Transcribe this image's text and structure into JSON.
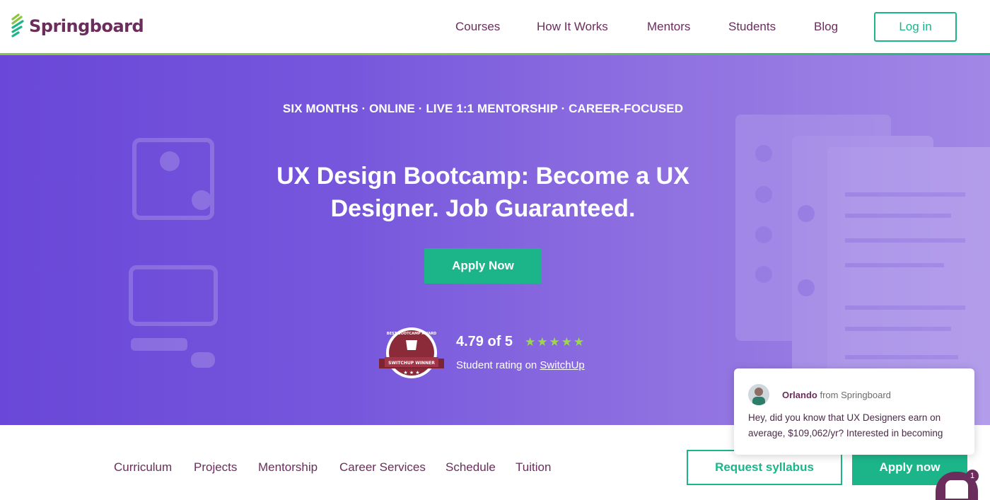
{
  "brand": {
    "name": "Springboard"
  },
  "nav": {
    "items": [
      "Courses",
      "How It Works",
      "Mentors",
      "Students",
      "Blog"
    ],
    "login_label": "Log in"
  },
  "hero": {
    "tagline": "SIX MONTHS · ONLINE · LIVE 1:1 MENTORSHIP · CAREER-FOCUSED",
    "title": "UX Design Bootcamp: Become a UX Designer. Job Guaranteed.",
    "cta_label": "Apply Now",
    "rating": "4.79 of 5",
    "rating_stars": 5,
    "rating_text": "Student rating on ",
    "rating_link": "SwitchUp",
    "badge_top_text": "BEST BOOTCAMP AWARD",
    "badge_bottom_text": "SWITCHUP WINNER"
  },
  "subnav": {
    "items": [
      "Curriculum",
      "Projects",
      "Mentorship",
      "Career Services",
      "Schedule",
      "Tuition"
    ],
    "request_label": "Request syllabus",
    "apply_label": "Apply now"
  },
  "chat": {
    "sender": "Orlando",
    "from_text": " from Springboard",
    "message": "Hey, did you know that UX Designers earn on average, $109,062/yr? Interested in becoming",
    "unread_count": "1"
  },
  "colors": {
    "brand_purple": "#6b2d5c",
    "accent_green": "#1cb58a",
    "hero_start": "#6a47d8",
    "hero_end": "#a287e6",
    "star": "#9cd94a"
  }
}
